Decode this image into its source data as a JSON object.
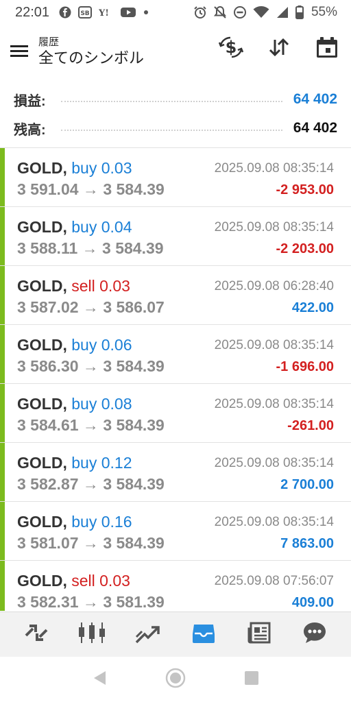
{
  "status_bar": {
    "time": "22:01",
    "battery_text": "55%",
    "left_icons": [
      "facebook-icon",
      "sb-app-icon",
      "yahoo-icon",
      "youtube-icon",
      "dot-icon"
    ],
    "right_icons": [
      "alarm-icon",
      "mute-icon",
      "dnd-icon",
      "wifi-icon",
      "signal-icon",
      "battery-icon"
    ]
  },
  "app_bar": {
    "subtitle": "履歴",
    "title": "全てのシンボル",
    "actions": [
      "currency-exchange-icon",
      "sort-icon",
      "calendar-icon"
    ]
  },
  "summary": {
    "profit_label": "損益:",
    "profit_value": "64 402",
    "balance_label": "残高:",
    "balance_value": "64 402"
  },
  "colors": {
    "accent_blue": "#1a7fd6",
    "loss_red": "#d32020",
    "side_bar_green": "#7cbb1e",
    "active_nav_blue": "#2a8fe0"
  },
  "trades": [
    {
      "symbol": "GOLD",
      "type": "buy",
      "volume": "0.03",
      "open": "3 591.04",
      "arrow": "→",
      "close": "3 584.39",
      "time": "2025.09.08 08:35:14",
      "profit": "-2 953.00",
      "profit_sign": "neg"
    },
    {
      "symbol": "GOLD",
      "type": "buy",
      "volume": "0.04",
      "open": "3 588.11",
      "arrow": "→",
      "close": "3 584.39",
      "time": "2025.09.08 08:35:14",
      "profit": "-2 203.00",
      "profit_sign": "neg"
    },
    {
      "symbol": "GOLD",
      "type": "sell",
      "volume": "0.03",
      "open": "3 587.02",
      "arrow": "→",
      "close": "3 586.07",
      "time": "2025.09.08 06:28:40",
      "profit": "422.00",
      "profit_sign": "pos"
    },
    {
      "symbol": "GOLD",
      "type": "buy",
      "volume": "0.06",
      "open": "3 586.30",
      "arrow": "→",
      "close": "3 584.39",
      "time": "2025.09.08 08:35:14",
      "profit": "-1 696.00",
      "profit_sign": "neg"
    },
    {
      "symbol": "GOLD",
      "type": "buy",
      "volume": "0.08",
      "open": "3 584.61",
      "arrow": "→",
      "close": "3 584.39",
      "time": "2025.09.08 08:35:14",
      "profit": "-261.00",
      "profit_sign": "neg"
    },
    {
      "symbol": "GOLD",
      "type": "buy",
      "volume": "0.12",
      "open": "3 582.87",
      "arrow": "→",
      "close": "3 584.39",
      "time": "2025.09.08 08:35:14",
      "profit": "2 700.00",
      "profit_sign": "pos"
    },
    {
      "symbol": "GOLD",
      "type": "buy",
      "volume": "0.16",
      "open": "3 581.07",
      "arrow": "→",
      "close": "3 584.39",
      "time": "2025.09.08 08:35:14",
      "profit": "7 863.00",
      "profit_sign": "pos"
    },
    {
      "symbol": "GOLD",
      "type": "sell",
      "volume": "0.03",
      "open": "3 582.31",
      "arrow": "→",
      "close": "3 581.39",
      "time": "2025.09.08 07:56:07",
      "profit": "409.00",
      "profit_sign": "pos"
    }
  ],
  "bottom_nav": {
    "items": [
      "quotes-icon",
      "chart-icon",
      "trade-icon",
      "history-icon",
      "news-icon",
      "chat-icon"
    ],
    "active": "history-icon"
  },
  "system_nav": [
    "back-icon",
    "home-icon",
    "recents-icon"
  ]
}
